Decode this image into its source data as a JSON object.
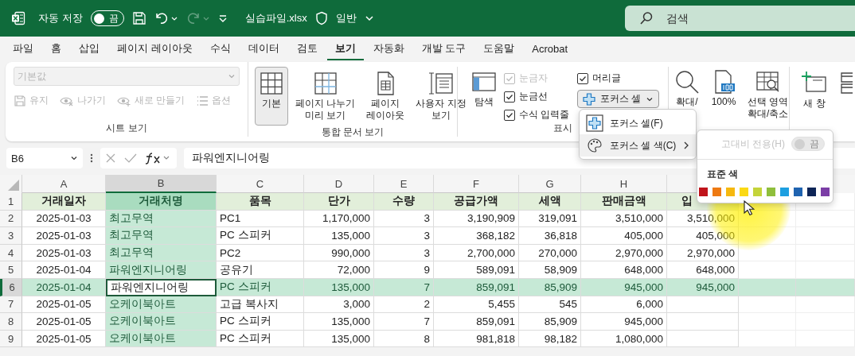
{
  "title_bar": {
    "autosave_label": "자동 저장",
    "autosave": {
      "on": false,
      "label": "끔"
    },
    "undo": {
      "disabled": false
    },
    "redo": {
      "disabled": true
    },
    "filename": "실습파일.xlsx",
    "sensitivity": "일반",
    "search": {
      "placeholder": "검색"
    }
  },
  "tabs": [
    {
      "label": "파일",
      "selected": false
    },
    {
      "label": "홈",
      "selected": false
    },
    {
      "label": "삽입",
      "selected": false
    },
    {
      "label": "페이지 레이아웃",
      "selected": false
    },
    {
      "label": "수식",
      "selected": false
    },
    {
      "label": "데이터",
      "selected": false
    },
    {
      "label": "검토",
      "selected": false
    },
    {
      "label": "보기",
      "selected": true
    },
    {
      "label": "자동화",
      "selected": false
    },
    {
      "label": "개발 도구",
      "selected": false
    },
    {
      "label": "도움말",
      "selected": false
    },
    {
      "label": "Acrobat",
      "selected": false
    }
  ],
  "sheet_view": {
    "title": "시트 보기",
    "dropdown": {
      "value": "기본값",
      "disabled": true
    },
    "buttons": [
      {
        "kind": "keep",
        "label": "유지",
        "disabled": true
      },
      {
        "kind": "exit",
        "label": "나가기",
        "disabled": true
      },
      {
        "kind": "new",
        "label": "새로 만들기",
        "disabled": true
      },
      {
        "kind": "options",
        "label": "옵션",
        "disabled": true
      }
    ]
  },
  "workbook_views": {
    "title": "통합 문서 보기",
    "buttons": [
      {
        "kind": "normal",
        "lines": [
          "기본"
        ],
        "selected": true
      },
      {
        "kind": "page-break",
        "lines": [
          "페이지 나누기",
          "미리 보기"
        ],
        "selected": false
      },
      {
        "kind": "page-layout",
        "lines": [
          "페이지",
          "레이아웃"
        ],
        "selected": false
      },
      {
        "kind": "custom",
        "lines": [
          "사용자 지정",
          "보기"
        ],
        "selected": false
      }
    ]
  },
  "show": {
    "title": "표시",
    "navigation": "탐색",
    "checkboxes": [
      {
        "label": "눈금자",
        "checked": true,
        "disabled": true
      },
      {
        "label": "눈금선",
        "checked": true,
        "disabled": false
      },
      {
        "label": "수식 입력줄",
        "checked": true,
        "disabled": false
      },
      {
        "label": "머리글",
        "checked": true,
        "disabled": false
      }
    ],
    "focus_cell": {
      "label": "포커스 셀",
      "expanded": true
    }
  },
  "zoom": {
    "buttons": [
      {
        "kind": "zoom",
        "lines": [
          "확대/"
        ]
      },
      {
        "kind": "hundred",
        "lines": [
          "100%"
        ]
      },
      {
        "kind": "selection",
        "lines": [
          "선택 영역",
          "확대/축소"
        ]
      }
    ]
  },
  "window": {
    "buttons": [
      {
        "kind": "new-window",
        "lines": [
          "새 창"
        ]
      },
      {
        "kind": "arrange"
      }
    ]
  },
  "focus_menu": {
    "items": [
      {
        "kind": "command",
        "label": "포커스 셀(F)",
        "expanded": false
      },
      {
        "kind": "submenu",
        "label": "포커스 셀 색(C)",
        "expanded": true
      }
    ]
  },
  "color_submenu": {
    "high_contrast": {
      "label": "고대비 전용(H)",
      "toggle_label": "끔",
      "on": false,
      "disabled": true
    },
    "section_label": "표준 색",
    "swatches": [
      {
        "color": "#c0141b"
      },
      {
        "color": "#ee7a12"
      },
      {
        "color": "#f6b80f"
      },
      {
        "color": "#fbd914"
      },
      {
        "color": "#c4d43a"
      },
      {
        "color": "#8fbf3c"
      },
      {
        "color": "#1d9fe0"
      },
      {
        "color": "#1f63b0"
      },
      {
        "color": "#0e2557"
      },
      {
        "color": "#7b3ea6"
      }
    ]
  },
  "formula_bar": {
    "name_box": "B6",
    "formula": "파워엔지니어링"
  },
  "grid": {
    "columns": [
      {
        "letter": "A",
        "kind": "date",
        "selected": false
      },
      {
        "letter": "B",
        "kind": "text",
        "selected": true
      },
      {
        "letter": "C",
        "kind": "text",
        "selected": false
      },
      {
        "letter": "D",
        "kind": "number",
        "selected": false
      },
      {
        "letter": "E",
        "kind": "number",
        "selected": false
      },
      {
        "letter": "F",
        "kind": "number",
        "selected": false
      },
      {
        "letter": "G",
        "kind": "number",
        "selected": false
      },
      {
        "letter": "H",
        "kind": "number",
        "selected": false
      },
      {
        "kind": "number",
        "selected": false
      }
    ],
    "rows": [
      {
        "number": "1",
        "kind": "header",
        "selected": false,
        "cells": [
          "거래일자",
          "거래처명",
          "품목",
          "단가",
          "수량",
          "공급가액",
          "세액",
          "판매금액",
          "입"
        ]
      },
      {
        "number": "2",
        "kind": "data",
        "selected": false,
        "cells": [
          "2025-01-03",
          "최고무역",
          "PC1",
          "1,170,000",
          "3",
          "3,190,909",
          "319,091",
          "3,510,000",
          "3,510,000"
        ]
      },
      {
        "number": "3",
        "kind": "data",
        "selected": false,
        "cells": [
          "2025-01-03",
          "최고무역",
          "PC 스피커",
          "135,000",
          "3",
          "368,182",
          "36,818",
          "405,000",
          "405,000"
        ]
      },
      {
        "number": "4",
        "kind": "data",
        "selected": false,
        "cells": [
          "2025-01-03",
          "최고무역",
          "PC2",
          "990,000",
          "3",
          "2,700,000",
          "270,000",
          "2,970,000",
          "2,970,000"
        ]
      },
      {
        "number": "5",
        "kind": "data",
        "selected": false,
        "cells": [
          "2025-01-04",
          "파워엔지니어링",
          "공유기",
          "72,000",
          "9",
          "589,091",
          "58,909",
          "648,000",
          "648,000"
        ]
      },
      {
        "number": "6",
        "kind": "data",
        "selected": true,
        "cells": [
          "2025-01-04",
          "파워엔지니어링",
          "PC 스피커",
          "135,000",
          "7",
          "859,091",
          "85,909",
          "945,000",
          "945,000"
        ]
      },
      {
        "number": "7",
        "kind": "data",
        "selected": false,
        "cells": [
          "2025-01-05",
          "오케이북아트",
          "고급 복사지",
          "3,000",
          "2",
          "5,455",
          "545",
          "6,000"
        ]
      },
      {
        "number": "8",
        "kind": "data",
        "selected": false,
        "cells": [
          "2025-01-05",
          "오케이북아트",
          "PC 스피커",
          "135,000",
          "7",
          "859,091",
          "85,909",
          "945,000"
        ]
      },
      {
        "number": "9",
        "kind": "data",
        "selected": false,
        "cells": [
          "2025-01-05",
          "오케이북아트",
          "PC 스피커",
          "135,000",
          "8",
          "981,818",
          "98,182",
          "1,080,000"
        ]
      }
    ]
  }
}
